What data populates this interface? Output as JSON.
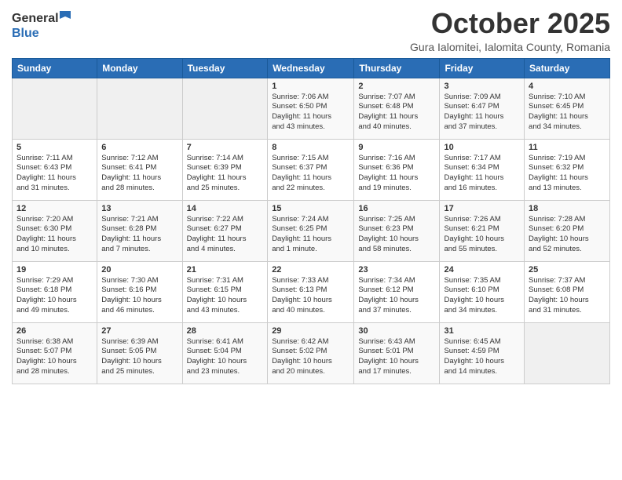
{
  "header": {
    "logo_general": "General",
    "logo_blue": "Blue",
    "month_title": "October 2025",
    "subtitle": "Gura Ialomitei, Ialomita County, Romania"
  },
  "days_of_week": [
    "Sunday",
    "Monday",
    "Tuesday",
    "Wednesday",
    "Thursday",
    "Friday",
    "Saturday"
  ],
  "weeks": [
    [
      {
        "day": "",
        "info": ""
      },
      {
        "day": "",
        "info": ""
      },
      {
        "day": "",
        "info": ""
      },
      {
        "day": "1",
        "info": "Sunrise: 7:06 AM\nSunset: 6:50 PM\nDaylight: 11 hours\nand 43 minutes."
      },
      {
        "day": "2",
        "info": "Sunrise: 7:07 AM\nSunset: 6:48 PM\nDaylight: 11 hours\nand 40 minutes."
      },
      {
        "day": "3",
        "info": "Sunrise: 7:09 AM\nSunset: 6:47 PM\nDaylight: 11 hours\nand 37 minutes."
      },
      {
        "day": "4",
        "info": "Sunrise: 7:10 AM\nSunset: 6:45 PM\nDaylight: 11 hours\nand 34 minutes."
      }
    ],
    [
      {
        "day": "5",
        "info": "Sunrise: 7:11 AM\nSunset: 6:43 PM\nDaylight: 11 hours\nand 31 minutes."
      },
      {
        "day": "6",
        "info": "Sunrise: 7:12 AM\nSunset: 6:41 PM\nDaylight: 11 hours\nand 28 minutes."
      },
      {
        "day": "7",
        "info": "Sunrise: 7:14 AM\nSunset: 6:39 PM\nDaylight: 11 hours\nand 25 minutes."
      },
      {
        "day": "8",
        "info": "Sunrise: 7:15 AM\nSunset: 6:37 PM\nDaylight: 11 hours\nand 22 minutes."
      },
      {
        "day": "9",
        "info": "Sunrise: 7:16 AM\nSunset: 6:36 PM\nDaylight: 11 hours\nand 19 minutes."
      },
      {
        "day": "10",
        "info": "Sunrise: 7:17 AM\nSunset: 6:34 PM\nDaylight: 11 hours\nand 16 minutes."
      },
      {
        "day": "11",
        "info": "Sunrise: 7:19 AM\nSunset: 6:32 PM\nDaylight: 11 hours\nand 13 minutes."
      }
    ],
    [
      {
        "day": "12",
        "info": "Sunrise: 7:20 AM\nSunset: 6:30 PM\nDaylight: 11 hours\nand 10 minutes."
      },
      {
        "day": "13",
        "info": "Sunrise: 7:21 AM\nSunset: 6:28 PM\nDaylight: 11 hours\nand 7 minutes."
      },
      {
        "day": "14",
        "info": "Sunrise: 7:22 AM\nSunset: 6:27 PM\nDaylight: 11 hours\nand 4 minutes."
      },
      {
        "day": "15",
        "info": "Sunrise: 7:24 AM\nSunset: 6:25 PM\nDaylight: 11 hours\nand 1 minute."
      },
      {
        "day": "16",
        "info": "Sunrise: 7:25 AM\nSunset: 6:23 PM\nDaylight: 10 hours\nand 58 minutes."
      },
      {
        "day": "17",
        "info": "Sunrise: 7:26 AM\nSunset: 6:21 PM\nDaylight: 10 hours\nand 55 minutes."
      },
      {
        "day": "18",
        "info": "Sunrise: 7:28 AM\nSunset: 6:20 PM\nDaylight: 10 hours\nand 52 minutes."
      }
    ],
    [
      {
        "day": "19",
        "info": "Sunrise: 7:29 AM\nSunset: 6:18 PM\nDaylight: 10 hours\nand 49 minutes."
      },
      {
        "day": "20",
        "info": "Sunrise: 7:30 AM\nSunset: 6:16 PM\nDaylight: 10 hours\nand 46 minutes."
      },
      {
        "day": "21",
        "info": "Sunrise: 7:31 AM\nSunset: 6:15 PM\nDaylight: 10 hours\nand 43 minutes."
      },
      {
        "day": "22",
        "info": "Sunrise: 7:33 AM\nSunset: 6:13 PM\nDaylight: 10 hours\nand 40 minutes."
      },
      {
        "day": "23",
        "info": "Sunrise: 7:34 AM\nSunset: 6:12 PM\nDaylight: 10 hours\nand 37 minutes."
      },
      {
        "day": "24",
        "info": "Sunrise: 7:35 AM\nSunset: 6:10 PM\nDaylight: 10 hours\nand 34 minutes."
      },
      {
        "day": "25",
        "info": "Sunrise: 7:37 AM\nSunset: 6:08 PM\nDaylight: 10 hours\nand 31 minutes."
      }
    ],
    [
      {
        "day": "26",
        "info": "Sunrise: 6:38 AM\nSunset: 5:07 PM\nDaylight: 10 hours\nand 28 minutes."
      },
      {
        "day": "27",
        "info": "Sunrise: 6:39 AM\nSunset: 5:05 PM\nDaylight: 10 hours\nand 25 minutes."
      },
      {
        "day": "28",
        "info": "Sunrise: 6:41 AM\nSunset: 5:04 PM\nDaylight: 10 hours\nand 23 minutes."
      },
      {
        "day": "29",
        "info": "Sunrise: 6:42 AM\nSunset: 5:02 PM\nDaylight: 10 hours\nand 20 minutes."
      },
      {
        "day": "30",
        "info": "Sunrise: 6:43 AM\nSunset: 5:01 PM\nDaylight: 10 hours\nand 17 minutes."
      },
      {
        "day": "31",
        "info": "Sunrise: 6:45 AM\nSunset: 4:59 PM\nDaylight: 10 hours\nand 14 minutes."
      },
      {
        "day": "",
        "info": ""
      }
    ]
  ]
}
